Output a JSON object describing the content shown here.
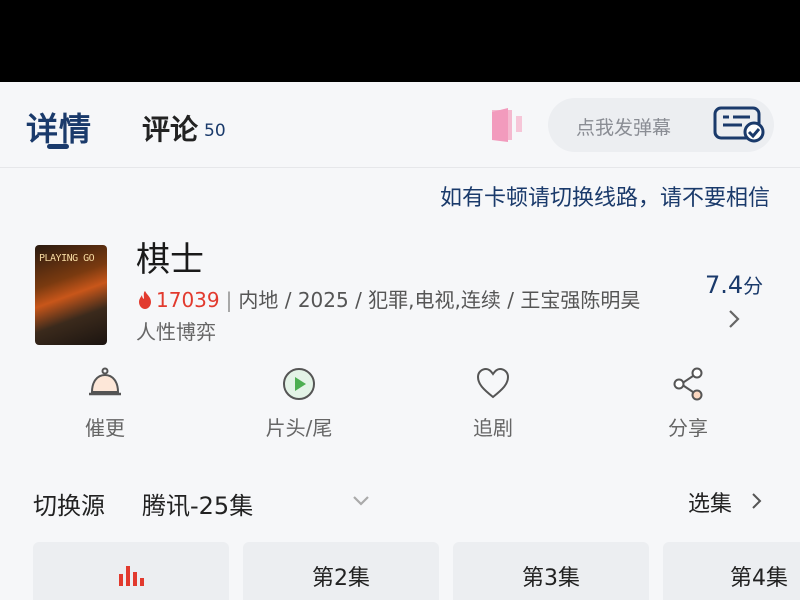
{
  "tabs": {
    "detail_label": "详情",
    "comment_label": "评论",
    "comment_count": "50"
  },
  "danmaku": {
    "placeholder": "点我发弹幕"
  },
  "notice": "如有卡顿请切换线路，请不要相信",
  "show": {
    "poster_text": "PLAYING GO",
    "title": "棋士",
    "hot_count": "17039",
    "meta": "内地 / 2025 / 犯罪,电视,连续 / 王宝强陈明昊",
    "subtitle": "人性博弈",
    "rating": "7.4",
    "rating_unit": "分"
  },
  "actions": [
    {
      "label": "催更",
      "icon": "bell-icon"
    },
    {
      "label": "片头/尾",
      "icon": "play-circle-icon"
    },
    {
      "label": "追剧",
      "icon": "heart-icon"
    },
    {
      "label": "分享",
      "icon": "share-icon"
    }
  ],
  "source": {
    "label": "切换源",
    "value": "腾讯-25集",
    "select_label": "选集"
  },
  "episodes": [
    {
      "label": "",
      "playing": true
    },
    {
      "label": "第2集"
    },
    {
      "label": "第3集"
    },
    {
      "label": "第4集"
    }
  ],
  "colors": {
    "accent": "#1a3a6b",
    "hot": "#e23a2e",
    "door": "#f29bbd",
    "playing": "#e23a2e"
  }
}
